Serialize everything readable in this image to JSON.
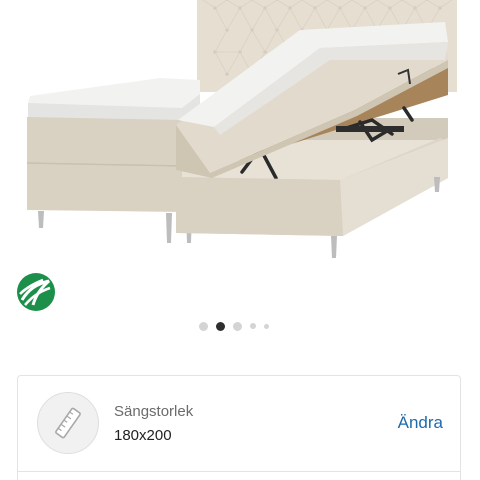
{
  "gallery": {
    "image_name": "storage-bed-product-photo",
    "eco_label_icon": "nordic-swan-ecolabel-icon",
    "slide_count": 5,
    "active_slide": 2
  },
  "size_option": {
    "icon": "bed-size-icon",
    "label": "Sängstorlek",
    "value": "180x200",
    "change_label": "Ändra",
    "accent_color": "#1d6bad"
  }
}
